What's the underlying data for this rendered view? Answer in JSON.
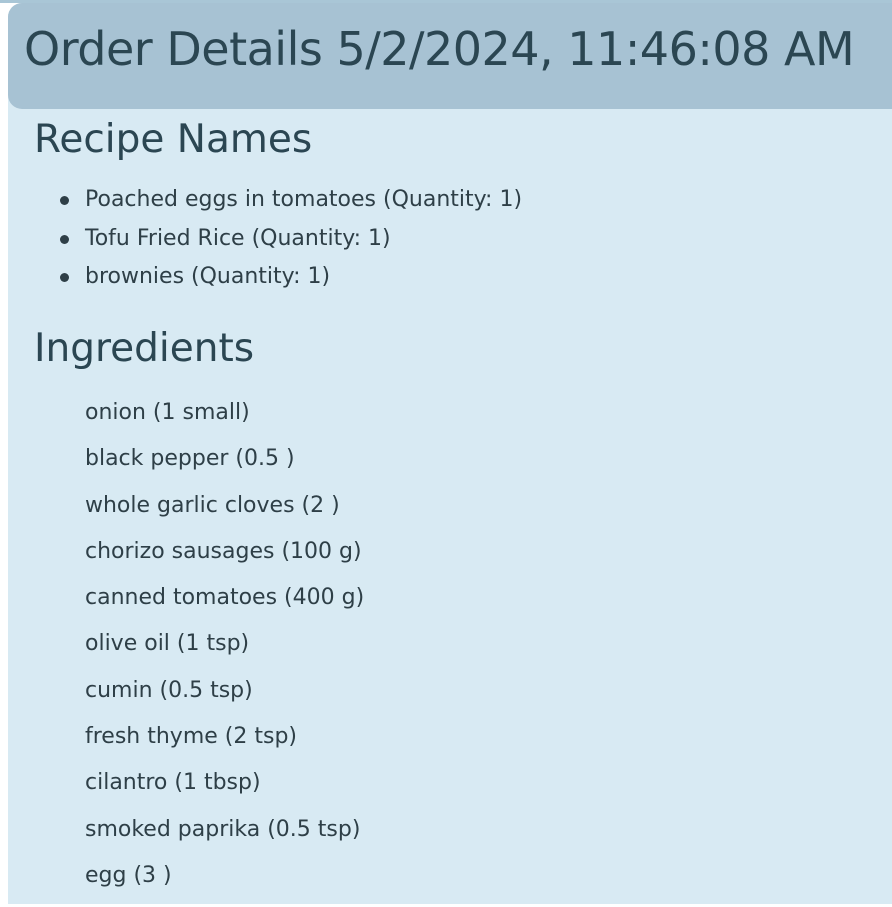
{
  "header": {
    "title": "Order Details 5/2/2024, 11:46:08 AM"
  },
  "recipes": {
    "title": "Recipe Names",
    "items": [
      "Poached eggs in tomatoes (Quantity: 1)",
      "Tofu Fried Rice (Quantity: 1)",
      "brownies (Quantity: 1)"
    ]
  },
  "ingredients": {
    "title": "Ingredients",
    "items": [
      "onion (1 small)",
      "black pepper (0.5 )",
      "whole garlic cloves (2 )",
      "chorizo sausages (100 g)",
      "canned tomatoes (400 g)",
      "olive oil (1 tsp)",
      "cumin (0.5 tsp)",
      "fresh thyme (2 tsp)",
      "cilantro (1 tbsp)",
      "smoked paprika (0.5 tsp)",
      "egg (3 )"
    ]
  },
  "colors": {
    "header_background": "#a7c2d3",
    "panel_background": "#d8eaf3",
    "title_text": "#2b4652",
    "body_text": "#2e3f47"
  }
}
